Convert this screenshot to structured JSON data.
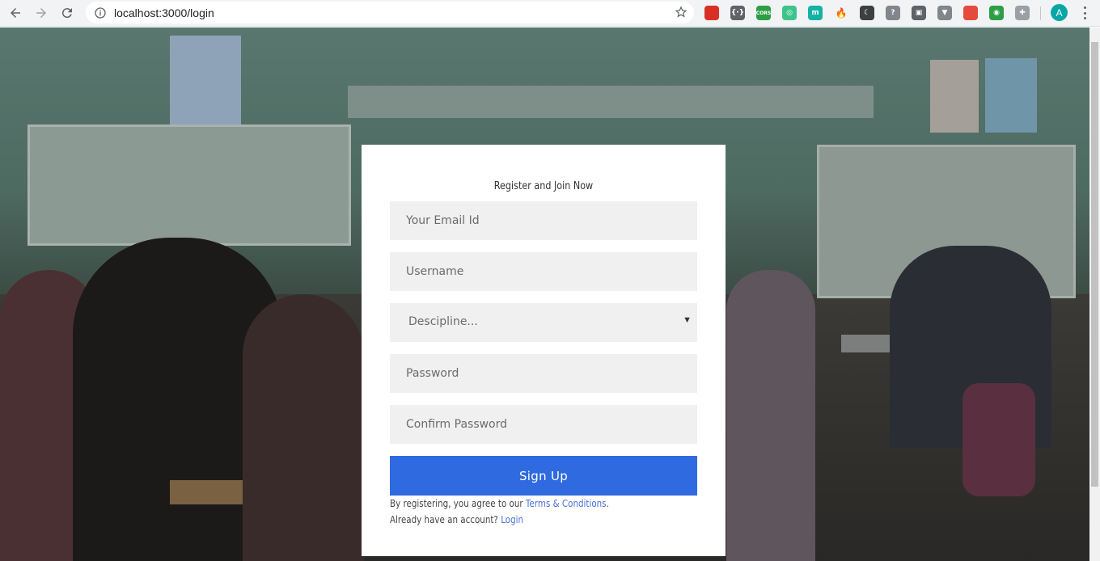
{
  "browser": {
    "url": "localhost:3000/login",
    "icons": {
      "back": "back-arrow-icon",
      "forward": "forward-arrow-icon",
      "reload": "reload-icon",
      "info": "info-icon",
      "bookmark": "star-icon"
    },
    "extensions": [
      {
        "name": "ext-red-icon",
        "label": "",
        "color": "#d93025"
      },
      {
        "name": "ext-code-icon",
        "label": "{·}",
        "color": "#5f6368"
      },
      {
        "name": "ext-cors-icon",
        "label": "CORS",
        "color": "#2e9e44"
      },
      {
        "name": "ext-refresh-icon",
        "label": "◎",
        "color": "#3cc48b"
      },
      {
        "name": "ext-m-icon",
        "label": "m",
        "color": "#12b3a6"
      },
      {
        "name": "ext-fire-icon",
        "label": "🔥",
        "color": "#f1f3f4"
      },
      {
        "name": "ext-moon-icon",
        "label": "☾",
        "color": "#3c4043"
      },
      {
        "name": "ext-shield-icon",
        "label": "?",
        "color": "#80868b"
      },
      {
        "name": "ext-bag-icon",
        "label": "▣",
        "color": "#5f6368"
      },
      {
        "name": "ext-v-icon",
        "label": "▼",
        "color": "#80868b"
      },
      {
        "name": "ext-angular-icon",
        "label": "",
        "color": "#e64a3d"
      },
      {
        "name": "ext-green-icon",
        "label": "◉",
        "color": "#2e9e44"
      },
      {
        "name": "ext-puzzle-icon",
        "label": "✚",
        "color": "#9aa0a6"
      }
    ],
    "profile_initial": "A",
    "profile_color": "#0aa6a6"
  },
  "form": {
    "title": "Register and Join Now",
    "email_placeholder": "Your Email Id",
    "username_placeholder": "Username",
    "discipline_placeholder": "Descipline...",
    "password_placeholder": "Password",
    "confirm_placeholder": "Confirm Password",
    "submit_label": "Sign Up",
    "terms_prefix": "By registering, you agree to our",
    "terms_link": "Terms & Conditions",
    "terms_suffix": ".",
    "login_prefix": "Already have an account?",
    "login_link": "Login"
  },
  "colors": {
    "accent": "#2f6ae0",
    "link": "#4a6fd8",
    "field_bg": "#f0f0f0"
  }
}
